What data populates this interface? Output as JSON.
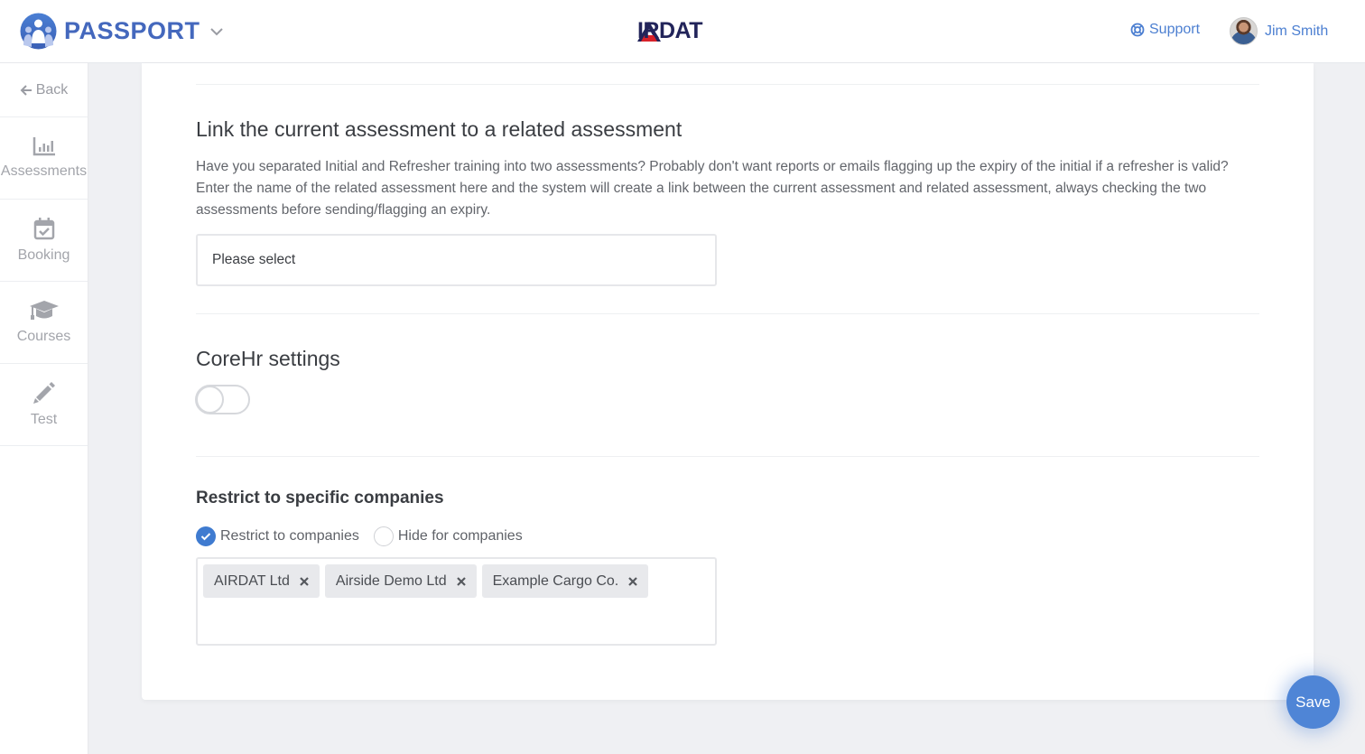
{
  "header": {
    "brand_name": "PASSPORT",
    "center_logo": "AIRDAT",
    "support_label": "Support",
    "user_name": "Jim Smith",
    "colors": {
      "brand": "#4468bd",
      "link": "#4c7fd1",
      "logo_navy": "#22245a",
      "logo_red": "#d8222a"
    }
  },
  "sidebar": {
    "back_label": "Back",
    "items": [
      {
        "label": "Assessments",
        "icon": "bar-chart-icon"
      },
      {
        "label": "Booking",
        "icon": "calendar-check-icon"
      },
      {
        "label": "Courses",
        "icon": "graduation-cap-icon"
      },
      {
        "label": "Test",
        "icon": "pencil-icon"
      }
    ]
  },
  "related_assessment": {
    "title": "Link the current assessment to a related assessment",
    "description": "Have you separated Initial and Refresher training into two assessments? Probably don't want reports or emails flagging up the expiry of the initial if a refresher is valid? Enter the name of the related assessment here and the system will create a link between the current assessment and related assessment, always checking the two assessments before sending/flagging an expiry.",
    "select_placeholder": "Please select"
  },
  "corehr": {
    "title": "CoreHr settings",
    "toggle_on": false
  },
  "restrict": {
    "title": "Restrict to specific companies",
    "options": [
      {
        "label": "Restrict to companies",
        "checked": true
      },
      {
        "label": "Hide for companies",
        "checked": false
      }
    ],
    "tags": [
      "AIRDAT Ltd",
      "Airside Demo Ltd",
      "Example Cargo Co."
    ]
  },
  "actions": {
    "save_label": "Save",
    "accent": "#4f85d6"
  }
}
